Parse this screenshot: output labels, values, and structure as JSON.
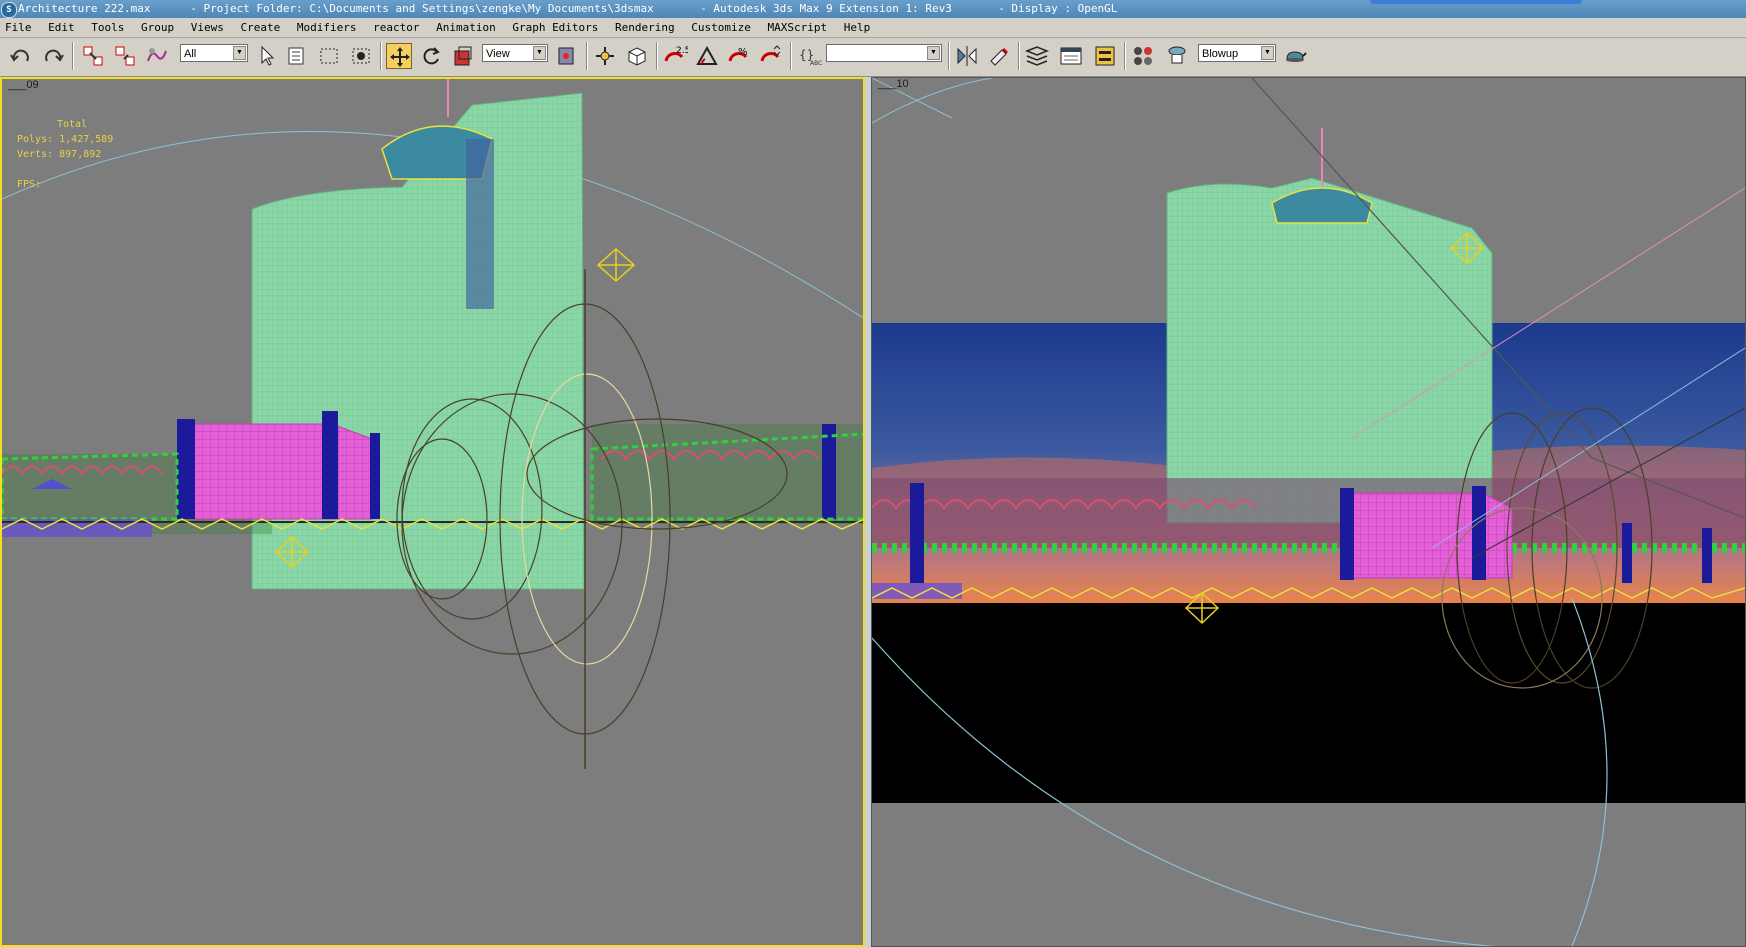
{
  "titlebar": {
    "file": "Architecture 222.max",
    "project": "- Project Folder: C:\\Documents and Settings\\zengke\\My Documents\\3dsmax",
    "app": "- Autodesk 3ds Max 9 Extension 1: Rev3",
    "display": "- Display : OpenGL"
  },
  "menu": [
    "File",
    "Edit",
    "Tools",
    "Group",
    "Views",
    "Create",
    "Modifiers",
    "reactor",
    "Animation",
    "Graph Editors",
    "Rendering",
    "Customize",
    "MAXScript",
    "Help"
  ],
  "toolbar": {
    "selection_filter": "All",
    "reference_coord": "View",
    "named_selection": "",
    "render_type": "Blowup",
    "icons": [
      "undo-icon",
      "redo-icon",
      "select-and-link-icon",
      "unlink-selection-icon",
      "bind-to-space-warp-icon",
      "select-object-icon",
      "select-by-name-icon",
      "rectangular-selection-region-icon",
      "window-crossing-icon",
      "select-and-move-icon",
      "select-and-rotate-icon",
      "select-and-scale-icon",
      "use-pivot-center-icon",
      "select-and-manipulate-icon",
      "keyboard-shortcut-override-icon",
      "snaps-toggle-icon",
      "angle-snap-icon",
      "percent-snap-icon",
      "spinner-snap-icon",
      "edit-named-selection-icon",
      "mirror-icon",
      "align-icon",
      "layer-manager-icon",
      "curve-editor-icon",
      "schematic-view-icon",
      "material-editor-icon",
      "render-scene-icon",
      "quick-render-icon"
    ]
  },
  "viewports": {
    "left": {
      "label": "___09",
      "stats_total": "Total",
      "stats_polys": "Polys: 1,427,589",
      "stats_verts": "Verts: 897,892",
      "stats_fps": "FPS:",
      "active": true
    },
    "right": {
      "label": "___10",
      "active": false
    }
  },
  "colors": {
    "viewport_bg": "#7d7d7d",
    "active_border": "#f0e020",
    "building": "#88d8a4",
    "arcade": "#e85ce0",
    "columns": "#1a1a9a",
    "sky_top": "#1e3a8a",
    "sky_horizon": "#e87c50"
  }
}
